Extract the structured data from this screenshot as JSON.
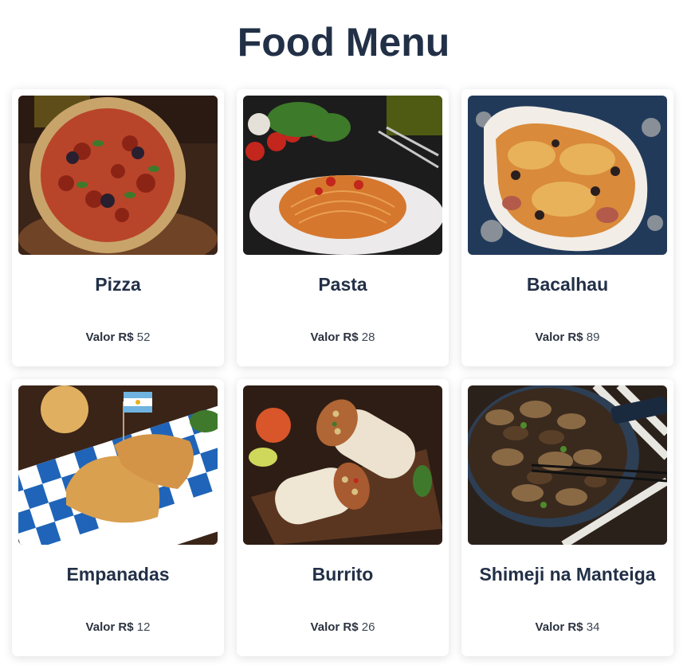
{
  "page": {
    "title": "Food Menu"
  },
  "items": [
    {
      "name": "Pizza",
      "price_label": "Valor R$",
      "price": "52",
      "image": "pizza-photo"
    },
    {
      "name": "Pasta",
      "price_label": "Valor R$",
      "price": "28",
      "image": "pasta-photo"
    },
    {
      "name": "Bacalhau",
      "price_label": "Valor R$",
      "price": "89",
      "image": "bacalhau-photo"
    },
    {
      "name": "Empanadas",
      "price_label": "Valor R$",
      "price": "12",
      "image": "empanadas-photo"
    },
    {
      "name": "Burrito",
      "price_label": "Valor R$",
      "price": "26",
      "image": "burrito-photo"
    },
    {
      "name": "Shimeji na Manteiga",
      "price_label": "Valor R$",
      "price": "34",
      "image": "shimeji-photo"
    }
  ],
  "colors": {
    "title": "#223047",
    "card_bg": "#ffffff"
  }
}
